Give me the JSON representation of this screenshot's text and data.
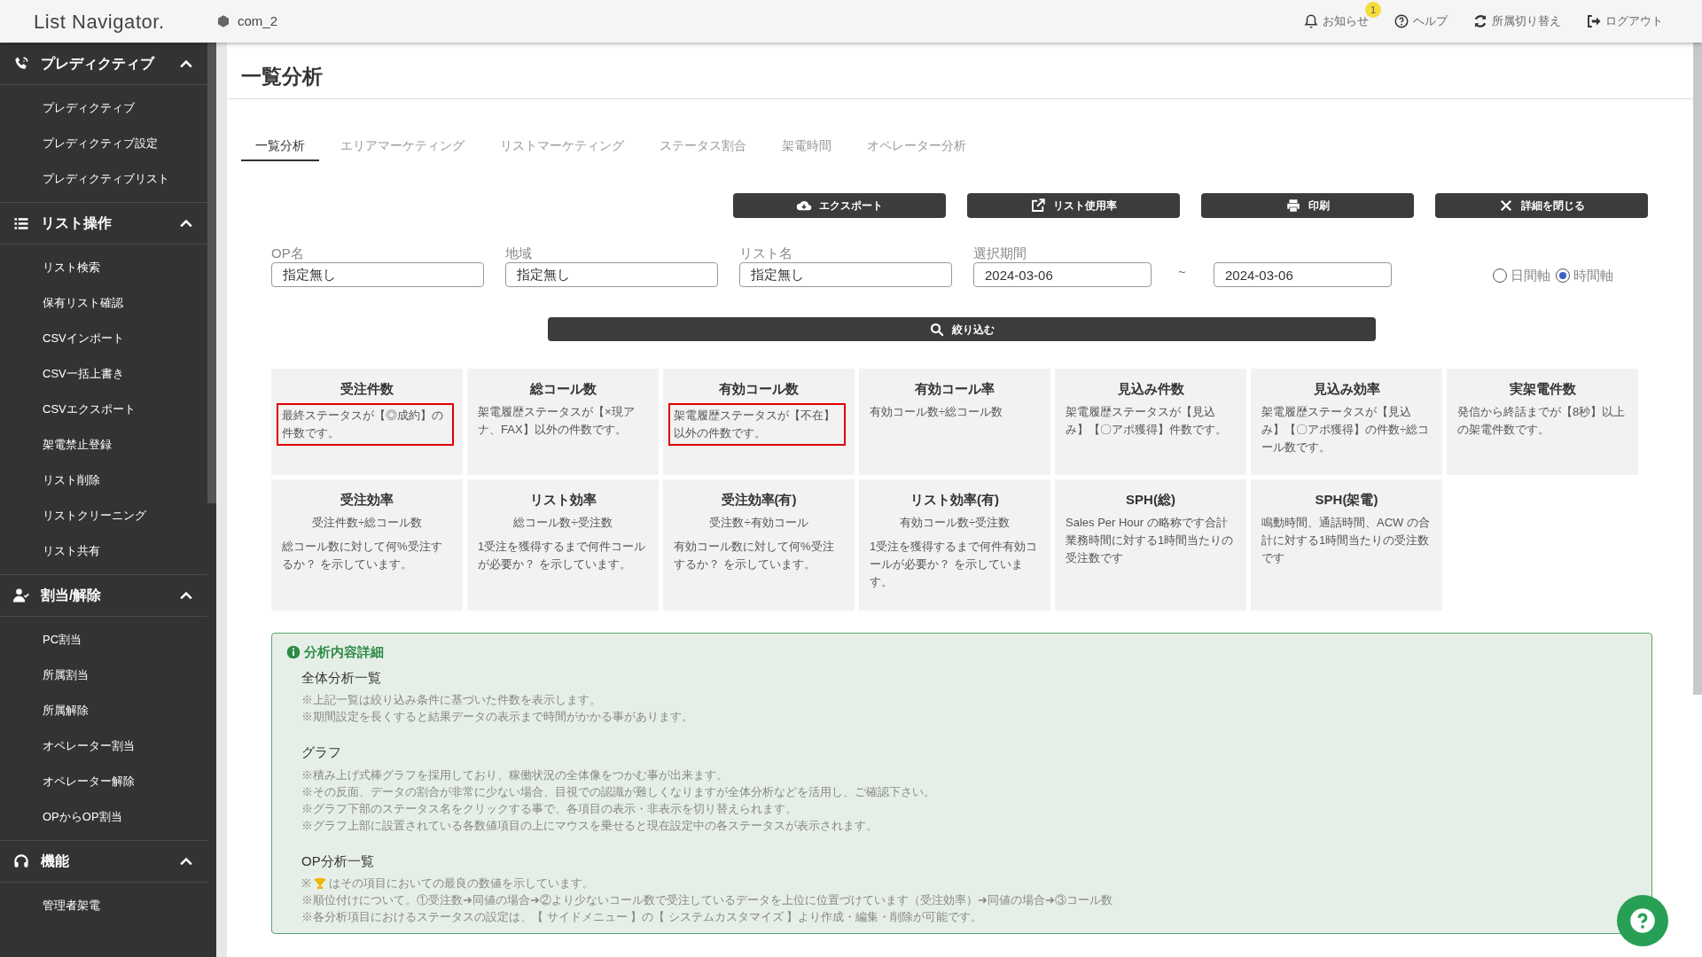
{
  "header": {
    "logo": "List Navigator.",
    "workspace": "com_2",
    "nav": [
      {
        "label": "お知らせ",
        "badge": "1"
      },
      {
        "label": "ヘルプ"
      },
      {
        "label": "所属切り替え"
      },
      {
        "label": "ログアウト"
      }
    ]
  },
  "sidebar": {
    "sections": [
      {
        "label": "プレディクティブ",
        "expanded": true,
        "items": [
          "プレディクティブ",
          "プレディクティブ設定",
          "プレディクティブリスト"
        ]
      },
      {
        "label": "リスト操作",
        "expanded": true,
        "items": [
          "リスト検索",
          "保有リスト確認",
          "CSVインポート",
          "CSV一括上書き",
          "CSVエクスポート",
          "架電禁止登録",
          "リスト削除",
          "リストクリーニング",
          "リスト共有"
        ]
      },
      {
        "label": "割当/解除",
        "expanded": true,
        "items": [
          "PC割当",
          "所属割当",
          "所属解除",
          "オペレーター割当",
          "オペレーター解除",
          "OPからOP割当"
        ]
      },
      {
        "label": "機能",
        "expanded": true,
        "items": [
          "管理者架電"
        ]
      }
    ]
  },
  "page_title": "一覧分析",
  "tabs": [
    {
      "label": "一覧分析",
      "selected": true
    },
    {
      "label": "エリアマーケティング",
      "selected": false
    },
    {
      "label": "リストマーケティング",
      "selected": false
    },
    {
      "label": "ステータス割合",
      "selected": false
    },
    {
      "label": "架電時間",
      "selected": false
    },
    {
      "label": "オペレーター分析",
      "selected": false
    }
  ],
  "actions": [
    {
      "label": "エクスポート"
    },
    {
      "label": "リスト使用率"
    },
    {
      "label": "印刷"
    },
    {
      "label": "詳細を閉じる"
    }
  ],
  "filters": [
    {
      "label": "OP名",
      "value": "指定無し"
    },
    {
      "label": "地域",
      "value": "指定無し"
    },
    {
      "label": "リスト名",
      "value": "指定無し"
    }
  ],
  "period": {
    "label": "選択期間",
    "start": "2024-03-06",
    "separator": "~",
    "end": "2024-03-06"
  },
  "axis_options": [
    {
      "label": "日間軸",
      "selected": false
    },
    {
      "label": "時間軸",
      "selected": true
    }
  ],
  "search_button": "絞り込む",
  "cards": [
    {
      "title": "受注件数",
      "description": "最終ステータスが【◎成約】の件数です。",
      "highlighted": true
    },
    {
      "title": "総コール数",
      "description": "架電履歴ステータスが【×現アナ、FAX】以外の件数です。",
      "highlighted": false
    },
    {
      "title": "有効コール数",
      "description": "架電履歴ステータスが【不在】以外の件数です。",
      "highlighted": true
    },
    {
      "title": "有効コール率",
      "description": "有効コール数÷総コール数",
      "highlighted": false
    },
    {
      "title": "見込み件数",
      "description": "架電履歴ステータスが【見込み】【〇アポ獲得】件数です。",
      "highlighted": false
    },
    {
      "title": "見込み効率",
      "description": "架電履歴ステータスが【見込み】【〇アポ獲得】の件数÷総コール数です。",
      "highlighted": false
    },
    {
      "title": "実架電件数",
      "description": "発信から終話までが【8秒】以上の架電件数です。",
      "highlighted": false
    },
    {
      "title": "受注効率",
      "formula": "受注件数÷総コール数",
      "description": "総コール数に対して何%受注するか？ を示しています。",
      "highlighted": false
    },
    {
      "title": "リスト効率",
      "formula": "総コール数÷受注数",
      "description": "1受注を獲得するまで何件コールが必要か？ を示しています。",
      "highlighted": false
    },
    {
      "title": "受注効率(有)",
      "formula": "受注数÷有効コール",
      "description": "有効コール数に対して何%受注するか？ を示しています。",
      "highlighted": false
    },
    {
      "title": "リスト効率(有)",
      "formula": "有効コール数÷受注数",
      "description": "1受注を獲得するまで何件有効コールが必要か？ を示しています。",
      "highlighted": false
    },
    {
      "title": "SPH(総)",
      "description": "Sales Per Hour の略称です合計業務時間に対する1時間当たりの受注数です",
      "highlighted": false
    },
    {
      "title": "SPH(架電)",
      "description": "鳴動時間、通話時間、ACW の合計に対する1時間当たりの受注数です",
      "highlighted": false
    }
  ],
  "details": {
    "title": "分析内容詳細",
    "sections": [
      {
        "heading": "全体分析一覧",
        "lines": [
          {
            "text": "※上記一覧は絞り込み条件に基づいた件数を表示します。"
          },
          {
            "text": "※期間設定を長くすると結果データの表示まで時間がかかる事があります。"
          }
        ]
      },
      {
        "heading": "グラフ",
        "lines": [
          {
            "text": "※積み上げ式棒グラフを採用しており、稼働状況の全体像をつかむ事が出来ます。"
          },
          {
            "text": "※その反面、データの割合が非常に少ない場合、目視での認識が難しくなりますが全体分析などを活用し、ご確認下さい。"
          },
          {
            "text": "※グラフ下部のステータス名をクリックする事で、各項目の表示・非表示を切り替えられます。"
          },
          {
            "text": "※グラフ上部に設置されている各数値項目の上にマウスを乗せると現在設定中の各ステータスが表示されます。"
          }
        ]
      },
      {
        "heading": "OP分析一覧",
        "lines": [
          {
            "kind": "trophy",
            "prefix": "※",
            "text": "はその項目においての最良の数値を示しています。"
          },
          {
            "text": "※順位付けについて。①受注数➜同値の場合➜②より少ないコール数で受注しているデータを上位に位置づけています（受注効率）➜同値の場合➜③コール数"
          },
          {
            "text": "※各分析項目におけるステータスの設定は、【 サイドメニュー 】の【 システムカスタマイズ 】より作成・編集・削除が可能です。"
          }
        ]
      }
    ]
  }
}
